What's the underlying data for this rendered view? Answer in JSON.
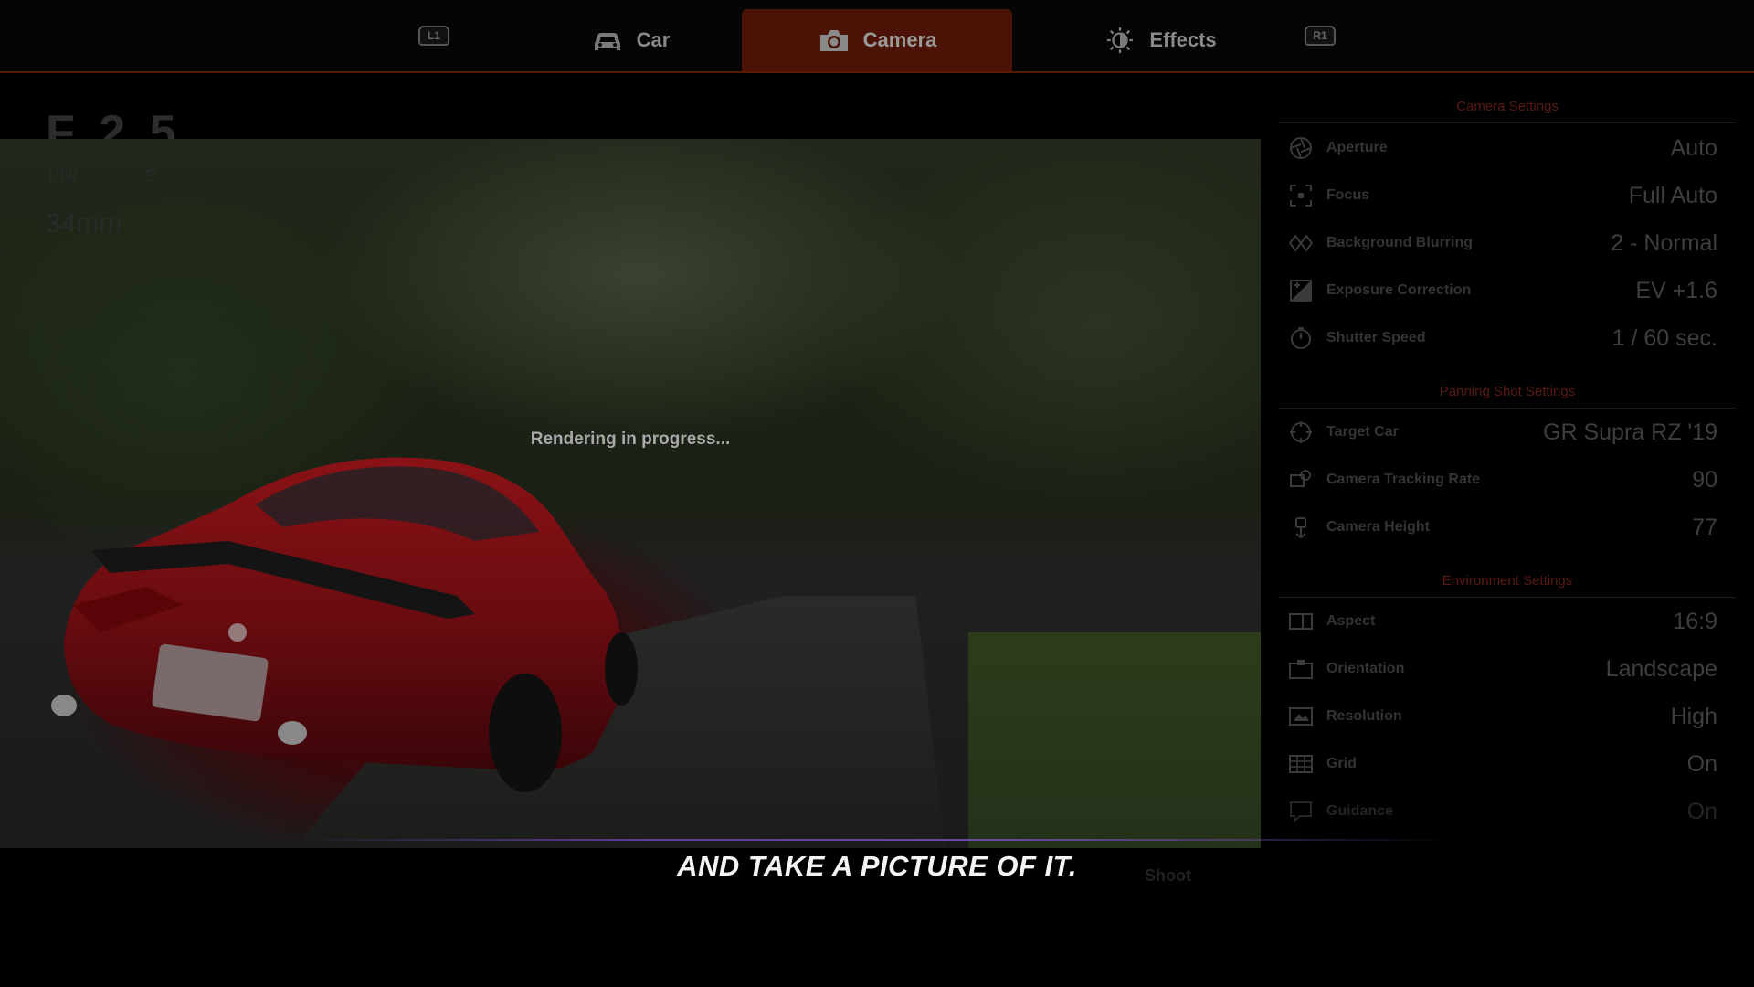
{
  "tabs": {
    "left_shoulder": "L1",
    "right_shoulder": "R1",
    "car": "Car",
    "camera": "Camera",
    "effects": "Effects"
  },
  "overlay": {
    "fstop": "F 2.5",
    "shutter": "1/60",
    "mode": "E",
    "focal": "34mm"
  },
  "viewport": {
    "rendering_text": "Rendering in progress..."
  },
  "panel": {
    "camera_settings_title": "Camera Settings",
    "panning_title": "Panning Shot Settings",
    "environment_title": "Environment Settings",
    "camera_rows": [
      {
        "label": "Aperture",
        "value": "Auto",
        "icon": "aperture-icon"
      },
      {
        "label": "Focus",
        "value": "Full Auto",
        "icon": "focus-icon"
      },
      {
        "label": "Background Blurring",
        "value": "2 - Normal",
        "icon": "blur-icon"
      },
      {
        "label": "Exposure Correction",
        "value": "EV +1.6",
        "icon": "exposure-icon"
      },
      {
        "label": "Shutter Speed",
        "value": "1 / 60 sec.",
        "icon": "stopwatch-icon"
      }
    ],
    "panning_rows": [
      {
        "label": "Target Car",
        "value": "GR Supra RZ '19",
        "icon": "target-icon"
      },
      {
        "label": "Camera Tracking Rate",
        "value": "90",
        "icon": "tracking-icon"
      },
      {
        "label": "Camera Height",
        "value": "77",
        "icon": "height-icon"
      }
    ],
    "environment_rows": [
      {
        "label": "Aspect",
        "value": "16:9",
        "icon": "aspect-icon"
      },
      {
        "label": "Orientation",
        "value": "Landscape",
        "icon": "orientation-icon"
      },
      {
        "label": "Resolution",
        "value": "High",
        "icon": "resolution-icon"
      },
      {
        "label": "Grid",
        "value": "On",
        "icon": "grid-icon"
      },
      {
        "label": "Guidance",
        "value": "On",
        "icon": "guidance-icon"
      }
    ]
  },
  "shoot_label": "Shoot",
  "subtitle": "AND TAKE A PICTURE OF IT."
}
